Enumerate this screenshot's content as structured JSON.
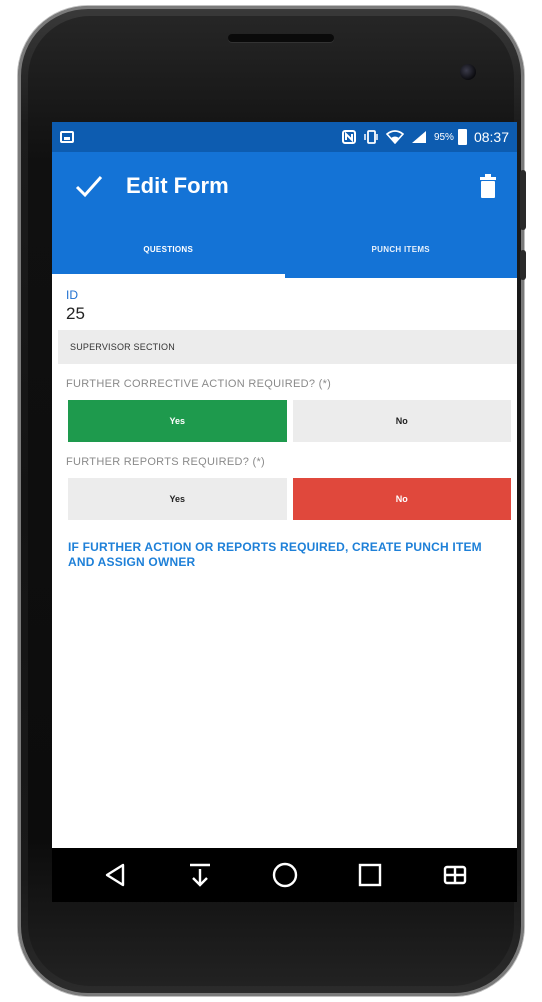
{
  "status_bar": {
    "battery_percent": "95%",
    "time": "08:37",
    "icons": [
      "screenshot-icon",
      "nfc-icon",
      "vibrate-icon",
      "wifi-icon",
      "signal-icon",
      "battery-icon"
    ]
  },
  "app_bar": {
    "title": "Edit Form",
    "icons": [
      "check-icon",
      "trash-icon"
    ]
  },
  "tabs": [
    {
      "label": "QUESTIONS",
      "active": true
    },
    {
      "label": "PUNCH ITEMS",
      "active": false
    }
  ],
  "form": {
    "id_label": "ID",
    "id_value": "25",
    "section_title": "SUPERVISOR SECTION",
    "questions": [
      {
        "label": "FURTHER CORRECTIVE ACTION REQUIRED? (*)",
        "options": [
          "Yes",
          "No"
        ],
        "selected": "Yes"
      },
      {
        "label": "FURTHER REPORTS REQUIRED? (*)",
        "options": [
          "Yes",
          "No"
        ],
        "selected": "No"
      }
    ],
    "info_text": "IF FURTHER ACTION OR REPORTS REQUIRED, CREATE PUNCH ITEM AND ASSIGN OWNER"
  },
  "colors": {
    "status_bar": "#0d5cb0",
    "app_bar": "#1473d6",
    "yes_selected": "#1e9a4d",
    "no_selected": "#e0483c",
    "link": "#1e80d8"
  },
  "nav_bar": {
    "icons": [
      "back-icon",
      "download-icon",
      "home-icon",
      "recents-icon",
      "grid-icon"
    ]
  }
}
